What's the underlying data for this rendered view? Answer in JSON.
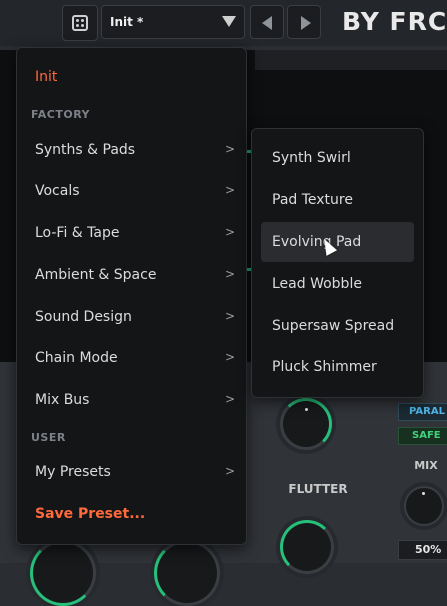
{
  "topbar": {
    "preset_name": "Init *",
    "brand": "BY FRCT"
  },
  "menu": {
    "init_label": "Init",
    "factory_header": "FACTORY",
    "factory_items": [
      {
        "label": "Synths & Pads",
        "chevron": ">"
      },
      {
        "label": "Vocals",
        "chevron": ">"
      },
      {
        "label": "Lo-Fi & Tape",
        "chevron": ">"
      },
      {
        "label": "Ambient & Space",
        "chevron": ">"
      },
      {
        "label": "Sound Design",
        "chevron": ">"
      },
      {
        "label": "Chain Mode",
        "chevron": ">"
      },
      {
        "label": "Mix Bus",
        "chevron": ">"
      }
    ],
    "user_header": "USER",
    "user_items": [
      {
        "label": "My Presets",
        "chevron": ">"
      }
    ],
    "save_label": "Save Preset..."
  },
  "submenu": {
    "items": [
      "Synth Swirl",
      "Pad Texture",
      "Evolving Pad",
      "Lead Wobble",
      "Supersaw Spread",
      "Pluck Shimmer"
    ],
    "hovered": "Evolving Pad"
  },
  "controls": {
    "flutter_label": "FLUTTER",
    "parallel_label": "PARAL",
    "safe_label": "SAFE",
    "mix_label": "MIX",
    "mix_value": "50%"
  },
  "colors": {
    "accent_orange": "#ff6a3c",
    "accent_green": "#27c07a",
    "accent_blue": "#4fb4e6"
  }
}
